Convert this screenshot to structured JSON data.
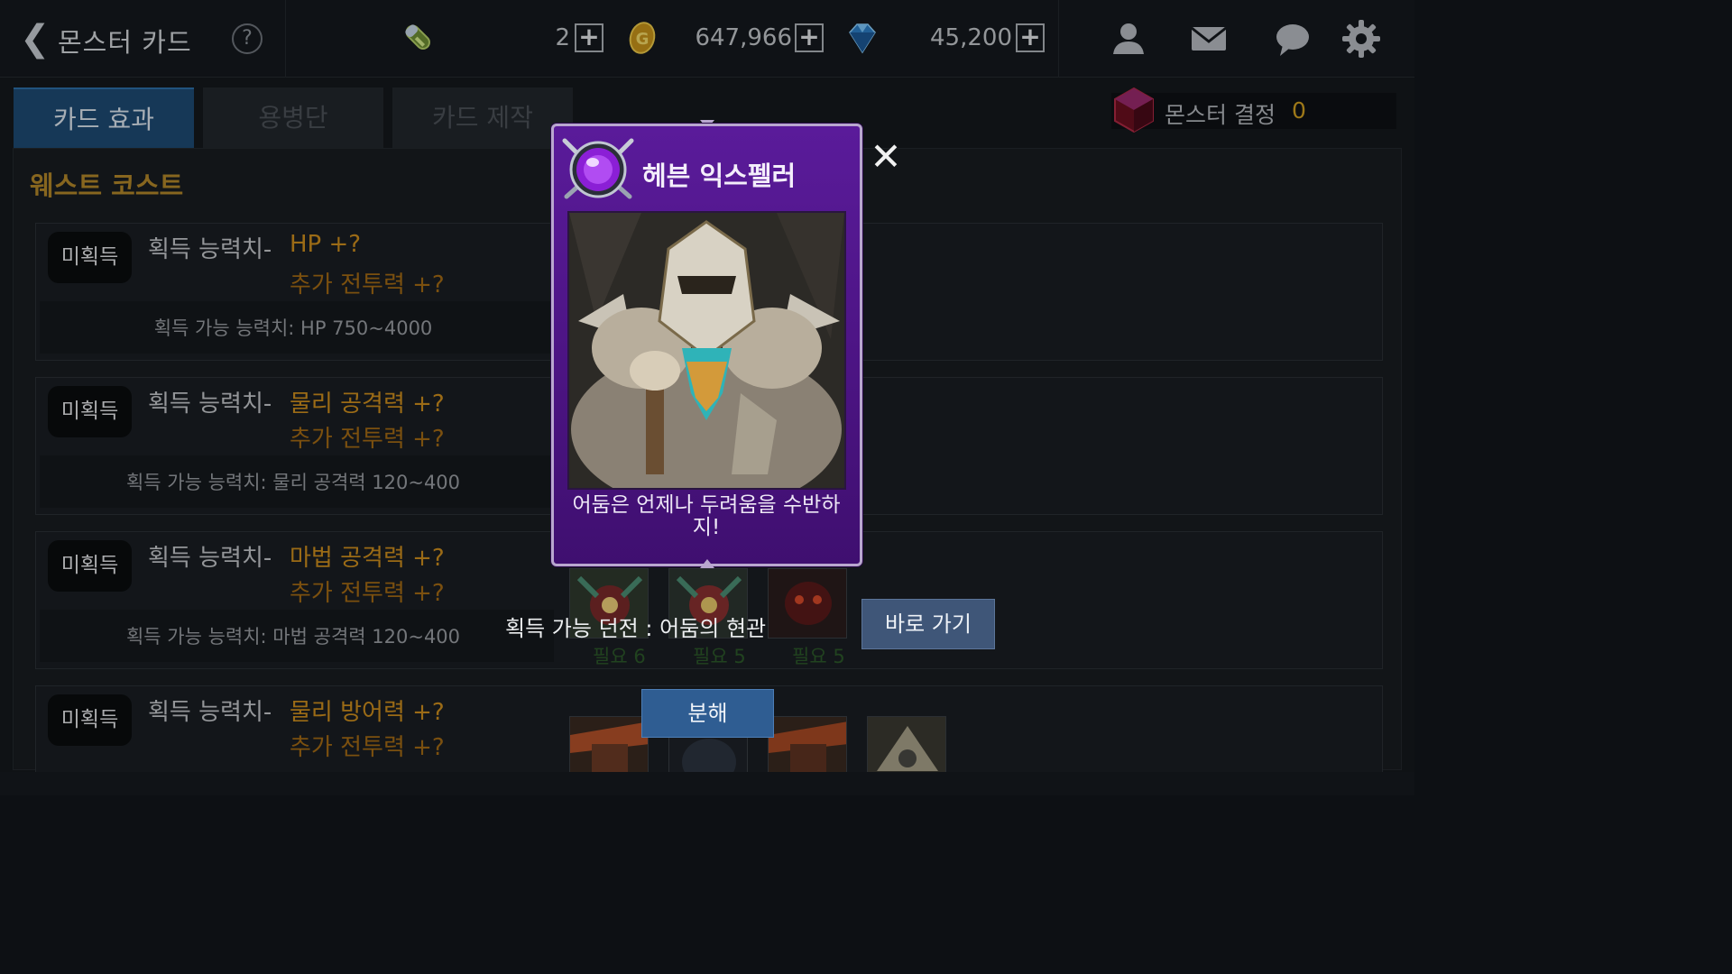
{
  "header": {
    "back_glyph": "❮",
    "title": "몬스터 카드",
    "help_glyph": "?",
    "energy": {
      "icon": "energy-vial-icon",
      "value": "2",
      "plus": "+"
    },
    "gold": {
      "icon": "gold-coin-icon",
      "value": "647,966",
      "plus": "+"
    },
    "gems": {
      "icon": "blue-gem-icon",
      "value": "45,200",
      "plus": "+"
    },
    "icons": [
      "friends-icon",
      "mail-icon",
      "chat-icon",
      "settings-icon"
    ]
  },
  "tabs": [
    {
      "label": "카드 효과",
      "active": true
    },
    {
      "label": "용병단",
      "active": false
    },
    {
      "label": "카드 제작",
      "active": false
    }
  ],
  "crystal": {
    "label": "몬스터 결정",
    "value": "0",
    "icon": "monster-crystal-icon"
  },
  "set_name": "웨스트 코스트",
  "card_rows": [
    {
      "badge": "미획득",
      "label": "획득 능력치-",
      "main": "HP +?",
      "sub": "추가 전투력 +?",
      "range": "획득 가능 능력치: HP 750~4000"
    },
    {
      "badge": "미획득",
      "label": "획득 능력치-",
      "main": "물리 공격력 +?",
      "sub": "추가 전투력 +?",
      "range": "획득 가능 능력치: 물리 공격력 120~400"
    },
    {
      "badge": "미획득",
      "label": "획득 능력치-",
      "main": "마법 공격력 +?",
      "sub": "추가 전투력 +?",
      "range": "획득 가능 능력치: 마법 공격력 120~400"
    },
    {
      "badge": "미획득",
      "label": "획득 능력치-",
      "main": "물리 방어력 +?",
      "sub": "추가 전투력 +?",
      "range": ""
    }
  ],
  "thumb_needs": [
    "필요 6",
    "필요 5",
    "필요 5"
  ],
  "popup": {
    "title": "헤븐 익스펠러",
    "quote": "어둠은 언제나 두려움을 수반하지!",
    "close_glyph": "✕",
    "dungeon_label": "획득 가능 던전 : 어둠의 현관",
    "goto_label": "바로 가기",
    "disassemble_label": "분해"
  },
  "colors": {
    "accent_gold": "#cf8f1e",
    "tab_active": "#1e4b74",
    "popup_purple": "#5a1b9a"
  }
}
